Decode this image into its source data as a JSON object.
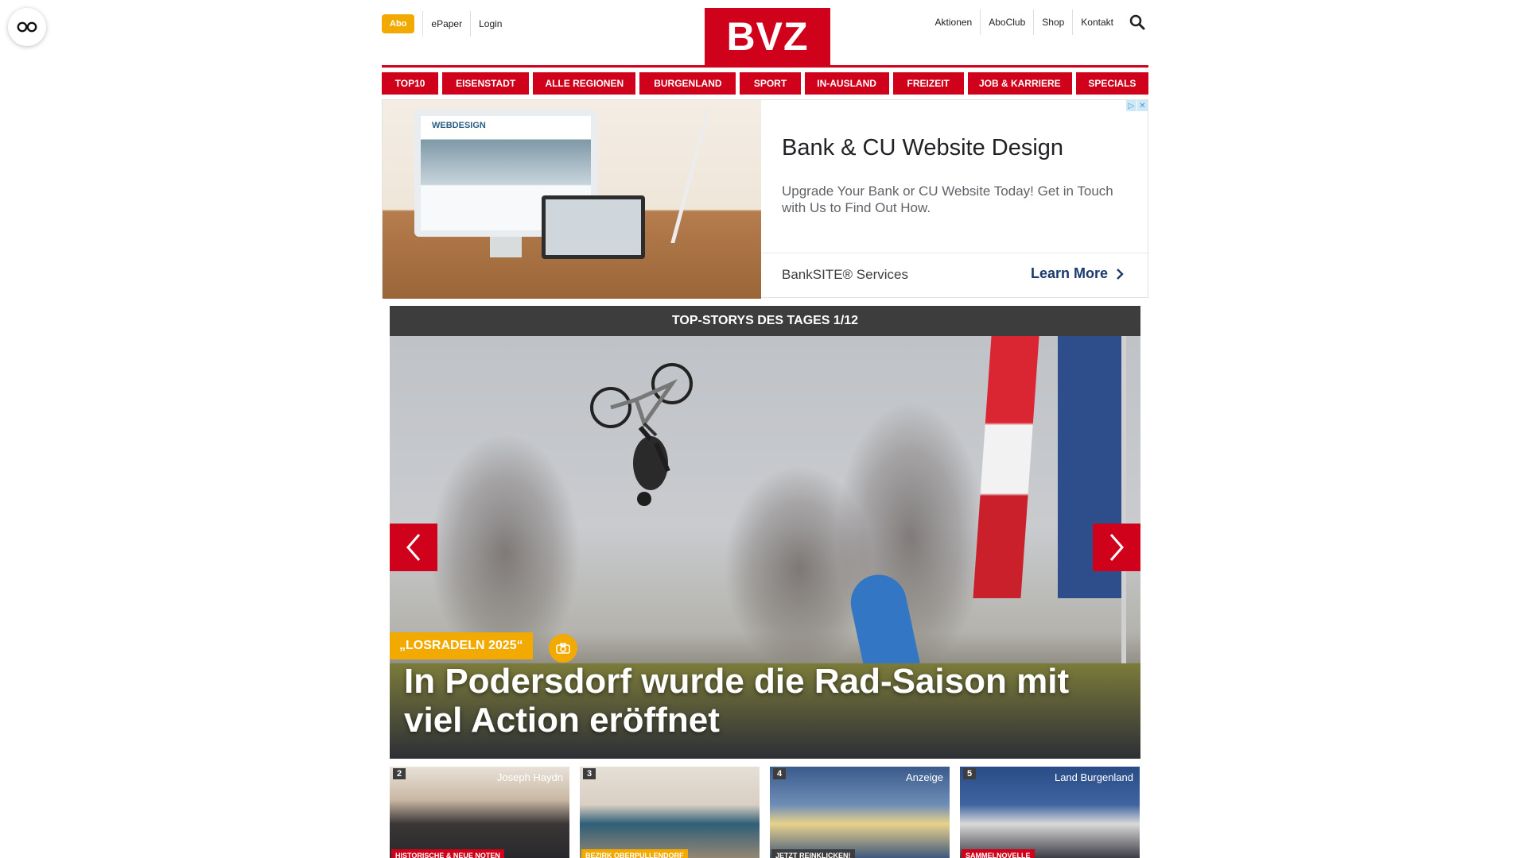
{
  "header": {
    "abo_label": "Abo",
    "left_links": [
      "ePaper",
      "Login"
    ],
    "logo_text": "BVZ",
    "right_links": [
      "Aktionen",
      "AboClub",
      "Shop",
      "Kontakt"
    ],
    "search_icon": "search-icon"
  },
  "nav": {
    "items": [
      "TOP10",
      "EISENSTADT",
      "ALLE REGIONEN",
      "BURGENLAND",
      "SPORT",
      "IN-AUSLAND",
      "FREIZEIT",
      "JOB & KARRIERE",
      "SPECIALS"
    ]
  },
  "ad": {
    "screen_text": "WEBDESIGN",
    "title": "Bank & CU Website Design",
    "description": "Upgrade Your Bank or CU Website Today! Get in Touch with Us to Find Out How.",
    "brand": "BankSITE® Services",
    "cta": "Learn More",
    "adchoices_icon": "adchoices-icon",
    "close_icon": "close-icon"
  },
  "stories": {
    "heading": "TOP-STORYS DES TAGES 1/12",
    "hero": {
      "kicker": "„LOSRADELN 2025“",
      "headline": "In Podersdorf wurde die Rad-Saison mit viel Action eröffnet",
      "camera_icon": "camera-icon"
    },
    "thumbs": [
      {
        "number": "2",
        "tag": "HISTORISCHE & NEUE NOTEN",
        "text": "Joseph Haydn"
      },
      {
        "number": "3",
        "tag": "BEZIRK OBERPULLENDORF",
        "text": ""
      },
      {
        "number": "4",
        "tag": "JETZT REINKLICKEN!",
        "text": "Anzeige"
      },
      {
        "number": "5",
        "tag": "SAMMELNOVELLE",
        "text": "Land Burgenland"
      }
    ]
  },
  "colors": {
    "brand_red": "#d0021b",
    "accent_yellow": "#f2a900",
    "dark_bar": "#3d3d3d"
  }
}
